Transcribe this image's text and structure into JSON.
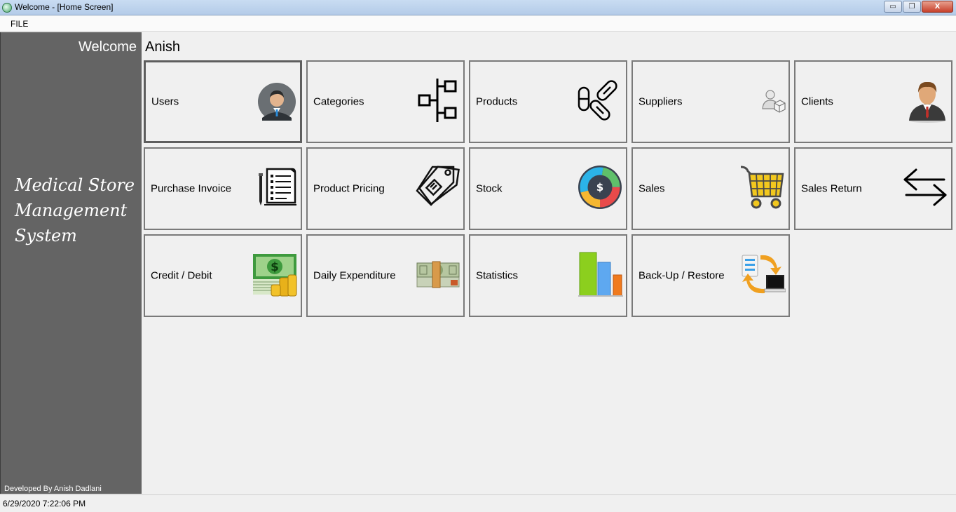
{
  "window": {
    "title": "Welcome - [Home Screen]",
    "minimize_glyph": "▭",
    "restore_glyph": "❐",
    "close_glyph": "X"
  },
  "menu": {
    "file": "FILE"
  },
  "sidebar": {
    "welcome": "Welcome",
    "app_name": "Medical Store Management System",
    "developer": "Developed By Anish Dadlani"
  },
  "user": {
    "name": "Anish"
  },
  "tiles": [
    {
      "label": "Users",
      "icon": "user-avatar-icon"
    },
    {
      "label": "Categories",
      "icon": "hierarchy-icon"
    },
    {
      "label": "Products",
      "icon": "capsules-icon"
    },
    {
      "label": "Suppliers",
      "icon": "supplier-icon"
    },
    {
      "label": "Clients",
      "icon": "client-icon"
    },
    {
      "label": "Purchase Invoice",
      "icon": "invoice-icon"
    },
    {
      "label": "Product Pricing",
      "icon": "price-tag-icon"
    },
    {
      "label": "Stock",
      "icon": "stock-dollar-icon"
    },
    {
      "label": "Sales",
      "icon": "shopping-cart-icon"
    },
    {
      "label": "Sales Return",
      "icon": "exchange-arrows-icon"
    },
    {
      "label": "Credit / Debit",
      "icon": "money-coins-icon"
    },
    {
      "label": "Daily Expenditure",
      "icon": "cash-stack-icon"
    },
    {
      "label": "Statistics",
      "icon": "bar-chart-icon"
    },
    {
      "label": "Back-Up / Restore",
      "icon": "backup-sync-icon"
    }
  ],
  "status": {
    "datetime": "6/29/2020 7:22:06 PM"
  }
}
